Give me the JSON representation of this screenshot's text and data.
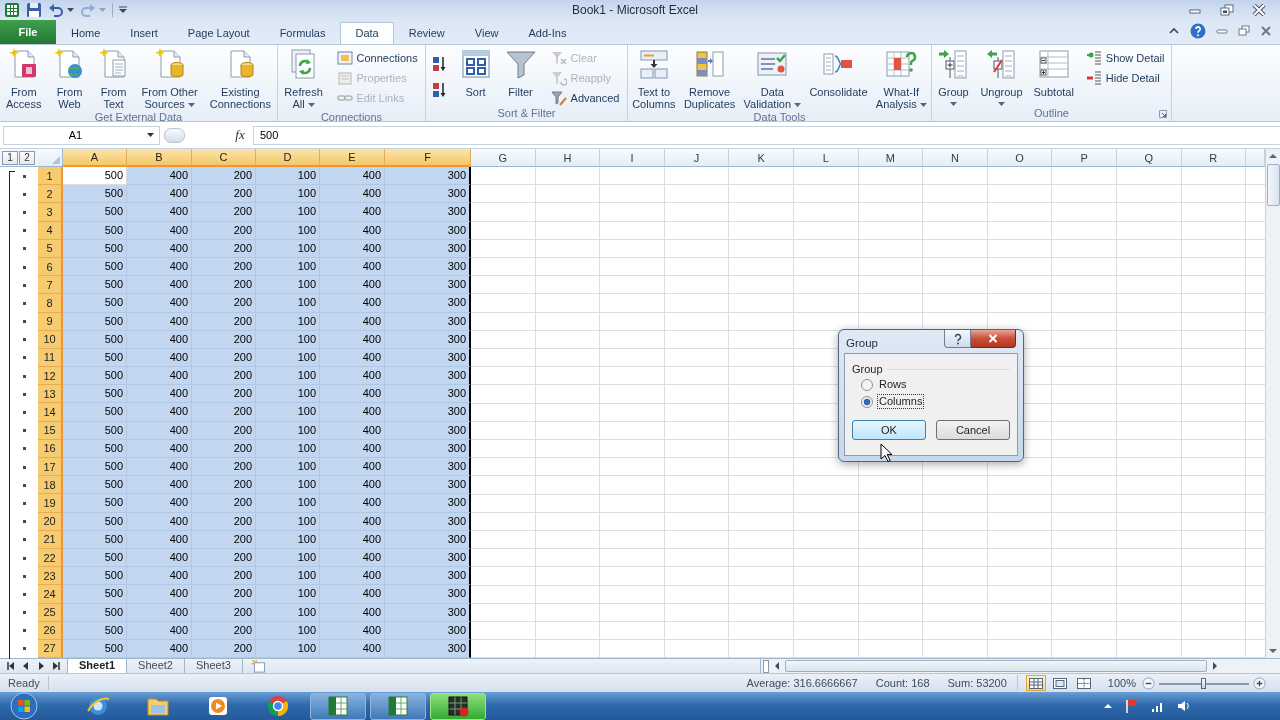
{
  "window": {
    "title": "Book1 - Microsoft Excel"
  },
  "quick_access": [
    {
      "kind": "save",
      "disabled": false,
      "menu": false
    },
    {
      "kind": "undo",
      "disabled": false,
      "menu": true
    },
    {
      "kind": "redo",
      "disabled": true,
      "menu": true
    }
  ],
  "tabs": [
    {
      "label": "File",
      "kind": "file",
      "selected": false
    },
    {
      "label": "Home",
      "kind": "tab",
      "selected": false
    },
    {
      "label": "Insert",
      "kind": "tab",
      "selected": false
    },
    {
      "label": "Page Layout",
      "kind": "tab",
      "selected": false
    },
    {
      "label": "Formulas",
      "kind": "tab",
      "selected": false
    },
    {
      "label": "Data",
      "kind": "tab",
      "selected": true
    },
    {
      "label": "Review",
      "kind": "tab",
      "selected": false
    },
    {
      "label": "View",
      "kind": "tab",
      "selected": false
    },
    {
      "label": "Add-Ins",
      "kind": "tab",
      "selected": false
    }
  ],
  "ribbon": {
    "groups": [
      {
        "label": "Get External Data",
        "launcher": false,
        "items": [
          {
            "kind": "large",
            "lines": [
              "From",
              "Access"
            ],
            "menu": false
          },
          {
            "kind": "large",
            "lines": [
              "From",
              "Web"
            ],
            "menu": false
          },
          {
            "kind": "large",
            "lines": [
              "From",
              "Text"
            ],
            "menu": false
          },
          {
            "kind": "large",
            "lines": [
              "From Other",
              "Sources"
            ],
            "menu": true
          },
          {
            "kind": "large",
            "lines": [
              "Existing",
              "Connections"
            ],
            "menu": false
          }
        ]
      },
      {
        "label": "Connections",
        "launcher": false,
        "items": [
          {
            "kind": "large",
            "lines": [
              "Refresh",
              "All"
            ],
            "menu": true
          },
          {
            "kind": "stack",
            "items": [
              {
                "label": "Connections",
                "disabled": false
              },
              {
                "label": "Properties",
                "disabled": true
              },
              {
                "label": "Edit Links",
                "disabled": true
              }
            ]
          }
        ]
      },
      {
        "label": "Sort & Filter",
        "launcher": false,
        "items": [
          {
            "kind": "sort_pair"
          },
          {
            "kind": "large",
            "lines": [
              "Sort"
            ],
            "menu": false
          },
          {
            "kind": "large",
            "lines": [
              "Filter"
            ],
            "menu": false
          },
          {
            "kind": "stack",
            "items": [
              {
                "label": "Clear",
                "disabled": true
              },
              {
                "label": "Reapply",
                "disabled": true
              },
              {
                "label": "Advanced",
                "disabled": false
              }
            ]
          }
        ]
      },
      {
        "label": "Data Tools",
        "launcher": false,
        "items": [
          {
            "kind": "large",
            "lines": [
              "Text to",
              "Columns"
            ],
            "menu": false
          },
          {
            "kind": "large",
            "lines": [
              "Remove",
              "Duplicates"
            ],
            "menu": false
          },
          {
            "kind": "large",
            "lines": [
              "Data",
              "Validation"
            ],
            "menu": true
          },
          {
            "kind": "large",
            "lines": [
              "Consolidate"
            ],
            "menu": false
          },
          {
            "kind": "large",
            "lines": [
              "What-If",
              "Analysis"
            ],
            "menu": true
          }
        ]
      },
      {
        "label": "Outline",
        "launcher": true,
        "items": [
          {
            "kind": "large",
            "lines": [
              "Group"
            ],
            "menu": true
          },
          {
            "kind": "large",
            "lines": [
              "Ungroup"
            ],
            "menu": true
          },
          {
            "kind": "large",
            "lines": [
              "Subtotal"
            ],
            "menu": false
          },
          {
            "kind": "stack",
            "items": [
              {
                "label": "Show Detail",
                "disabled": false
              },
              {
                "label": "Hide Detail",
                "disabled": false
              }
            ]
          }
        ]
      }
    ]
  },
  "formula_bar": {
    "name_box": "A1",
    "function_label": "fx",
    "value": "500"
  },
  "sheet": {
    "outline_levels": [
      "1",
      "2"
    ],
    "columns": [
      {
        "label": "A",
        "selected": true,
        "active": true
      },
      {
        "label": "B",
        "selected": true,
        "active": false
      },
      {
        "label": "C",
        "selected": true,
        "active": false
      },
      {
        "label": "D",
        "selected": true,
        "active": false
      },
      {
        "label": "E",
        "selected": true,
        "active": false
      },
      {
        "label": "F",
        "selected": true,
        "active": false
      },
      {
        "label": "G",
        "selected": false,
        "active": false
      },
      {
        "label": "H",
        "selected": false,
        "active": false
      },
      {
        "label": "I",
        "selected": false,
        "active": false
      },
      {
        "label": "J",
        "selected": false,
        "active": false
      },
      {
        "label": "K",
        "selected": false,
        "active": false
      },
      {
        "label": "L",
        "selected": false,
        "active": false
      },
      {
        "label": "M",
        "selected": false,
        "active": false
      },
      {
        "label": "N",
        "selected": false,
        "active": false
      },
      {
        "label": "O",
        "selected": false,
        "active": false
      },
      {
        "label": "P",
        "selected": false,
        "active": false
      },
      {
        "label": "Q",
        "selected": false,
        "active": false
      },
      {
        "label": "R",
        "selected": false,
        "active": false
      }
    ],
    "rows": [
      {
        "header": "1",
        "selected": true,
        "active": true,
        "grouped": true,
        "cells": [
          "500",
          "400",
          "200",
          "100",
          "400",
          "300"
        ]
      },
      {
        "header": "2",
        "selected": true,
        "active": false,
        "grouped": true,
        "cells": [
          "500",
          "400",
          "200",
          "100",
          "400",
          "300"
        ]
      },
      {
        "header": "3",
        "selected": true,
        "active": false,
        "grouped": true,
        "cells": [
          "500",
          "400",
          "200",
          "100",
          "400",
          "300"
        ]
      },
      {
        "header": "4",
        "selected": true,
        "active": false,
        "grouped": true,
        "cells": [
          "500",
          "400",
          "200",
          "100",
          "400",
          "300"
        ]
      },
      {
        "header": "5",
        "selected": true,
        "active": false,
        "grouped": true,
        "cells": [
          "500",
          "400",
          "200",
          "100",
          "400",
          "300"
        ]
      },
      {
        "header": "6",
        "selected": true,
        "active": false,
        "grouped": true,
        "cells": [
          "500",
          "400",
          "200",
          "100",
          "400",
          "300"
        ]
      },
      {
        "header": "7",
        "selected": true,
        "active": false,
        "grouped": true,
        "cells": [
          "500",
          "400",
          "200",
          "100",
          "400",
          "300"
        ]
      },
      {
        "header": "8",
        "selected": true,
        "active": false,
        "grouped": true,
        "cells": [
          "500",
          "400",
          "200",
          "100",
          "400",
          "300"
        ]
      },
      {
        "header": "9",
        "selected": true,
        "active": false,
        "grouped": true,
        "cells": [
          "500",
          "400",
          "200",
          "100",
          "400",
          "300"
        ]
      },
      {
        "header": "10",
        "selected": true,
        "active": false,
        "grouped": true,
        "cells": [
          "500",
          "400",
          "200",
          "100",
          "400",
          "300"
        ]
      },
      {
        "header": "11",
        "selected": true,
        "active": false,
        "grouped": true,
        "cells": [
          "500",
          "400",
          "200",
          "100",
          "400",
          "300"
        ]
      },
      {
        "header": "12",
        "selected": true,
        "active": false,
        "grouped": true,
        "cells": [
          "500",
          "400",
          "200",
          "100",
          "400",
          "300"
        ]
      },
      {
        "header": "13",
        "selected": true,
        "active": false,
        "grouped": true,
        "cells": [
          "500",
          "400",
          "200",
          "100",
          "400",
          "300"
        ]
      },
      {
        "header": "14",
        "selected": true,
        "active": false,
        "grouped": true,
        "cells": [
          "500",
          "400",
          "200",
          "100",
          "400",
          "300"
        ]
      },
      {
        "header": "15",
        "selected": true,
        "active": false,
        "grouped": true,
        "cells": [
          "500",
          "400",
          "200",
          "100",
          "400",
          "300"
        ]
      },
      {
        "header": "16",
        "selected": true,
        "active": false,
        "grouped": true,
        "cells": [
          "500",
          "400",
          "200",
          "100",
          "400",
          "300"
        ]
      },
      {
        "header": "17",
        "selected": true,
        "active": false,
        "grouped": true,
        "cells": [
          "500",
          "400",
          "200",
          "100",
          "400",
          "300"
        ]
      },
      {
        "header": "18",
        "selected": true,
        "active": false,
        "grouped": true,
        "cells": [
          "500",
          "400",
          "200",
          "100",
          "400",
          "300"
        ]
      },
      {
        "header": "19",
        "selected": true,
        "active": false,
        "grouped": true,
        "cells": [
          "500",
          "400",
          "200",
          "100",
          "400",
          "300"
        ]
      },
      {
        "header": "20",
        "selected": true,
        "active": false,
        "grouped": true,
        "cells": [
          "500",
          "400",
          "200",
          "100",
          "400",
          "300"
        ]
      },
      {
        "header": "21",
        "selected": true,
        "active": false,
        "grouped": true,
        "cells": [
          "500",
          "400",
          "200",
          "100",
          "400",
          "300"
        ]
      },
      {
        "header": "22",
        "selected": true,
        "active": false,
        "grouped": true,
        "cells": [
          "500",
          "400",
          "200",
          "100",
          "400",
          "300"
        ]
      },
      {
        "header": "23",
        "selected": true,
        "active": false,
        "grouped": true,
        "cells": [
          "500",
          "400",
          "200",
          "100",
          "400",
          "300"
        ]
      },
      {
        "header": "24",
        "selected": true,
        "active": false,
        "grouped": true,
        "cells": [
          "500",
          "400",
          "200",
          "100",
          "400",
          "300"
        ]
      },
      {
        "header": "25",
        "selected": true,
        "active": false,
        "grouped": true,
        "cells": [
          "500",
          "400",
          "200",
          "100",
          "400",
          "300"
        ]
      },
      {
        "header": "26",
        "selected": true,
        "active": false,
        "grouped": true,
        "cells": [
          "500",
          "400",
          "200",
          "100",
          "400",
          "300"
        ]
      },
      {
        "header": "27",
        "selected": true,
        "active": false,
        "grouped": true,
        "cells": [
          "500",
          "400",
          "200",
          "100",
          "400",
          "300"
        ]
      }
    ]
  },
  "sheet_tabs": [
    {
      "label": "Sheet1",
      "selected": true
    },
    {
      "label": "Sheet2",
      "selected": false
    },
    {
      "label": "Sheet3",
      "selected": false
    }
  ],
  "status_bar": {
    "mode": "Ready",
    "stats": [
      "Average: 316.6666667",
      "Count: 168",
      "Sum: 53200"
    ],
    "views": [
      {
        "selected": true
      },
      {
        "selected": false
      },
      {
        "selected": false
      }
    ],
    "zoom": "100%",
    "zoom_slider": {
      "level": 0.5
    }
  },
  "dialog": {
    "title": "Group",
    "group_label": "Group",
    "options": [
      {
        "label": "Rows",
        "selected": false
      },
      {
        "label": "Columns",
        "selected": true
      }
    ],
    "buttons": [
      {
        "label": "OK",
        "kind": "default"
      },
      {
        "label": "Cancel",
        "kind": "normal"
      }
    ]
  },
  "taskbar": {
    "items": [
      {
        "running": false,
        "highlighted": false
      },
      {
        "running": false,
        "highlighted": false
      },
      {
        "running": false,
        "highlighted": false
      },
      {
        "running": false,
        "highlighted": false
      },
      {
        "running": true,
        "highlighted": false
      },
      {
        "running": true,
        "highlighted": false
      },
      {
        "running": true,
        "highlighted": true
      }
    ]
  }
}
